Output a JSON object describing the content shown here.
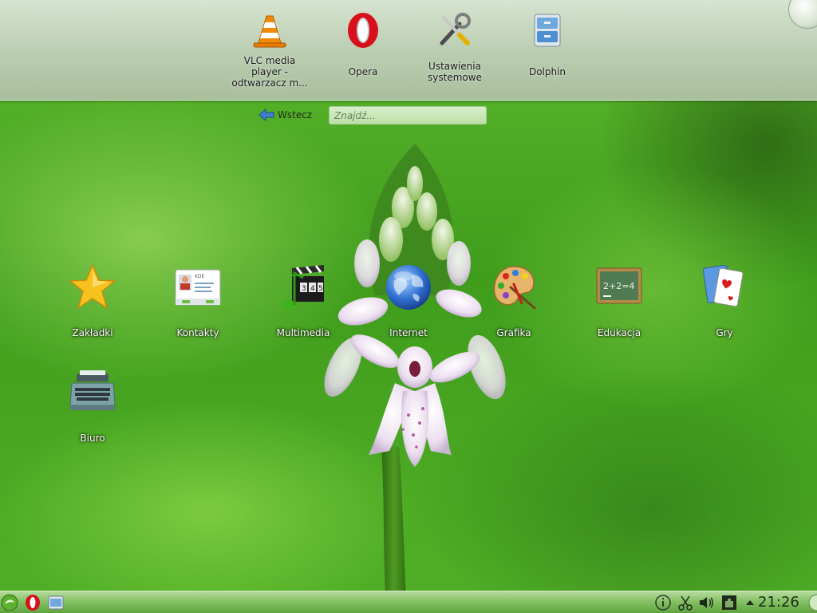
{
  "favorites": [
    {
      "name": "VLC media player - odtwarzacz m...",
      "label_lines": [
        "VLC media",
        "player -",
        "odtwarzacz m..."
      ],
      "icon": "vlc-cone-icon"
    },
    {
      "name": "Opera",
      "label_lines": [
        "Opera"
      ],
      "icon": "opera-icon"
    },
    {
      "name": "Ustawienia systemowe",
      "label_lines": [
        "Ustawienia",
        "systemowe"
      ],
      "icon": "system-settings-icon"
    },
    {
      "name": "Dolphin",
      "label_lines": [
        "Dolphin"
      ],
      "icon": "dolphin-file-manager-icon"
    }
  ],
  "navigation": {
    "back_label": "Wstecz",
    "search_placeholder": "Znajdź..."
  },
  "categories": [
    {
      "label": "Zakładki",
      "icon": "star-bookmarks-icon"
    },
    {
      "label": "Kontakty",
      "icon": "contacts-card-icon"
    },
    {
      "label": "Multimedia",
      "icon": "multimedia-clapper-icon"
    },
    {
      "label": "Internet",
      "icon": "globe-icon"
    },
    {
      "label": "Grafika",
      "icon": "paint-palette-icon"
    },
    {
      "label": "Edukacja",
      "icon": "chalkboard-icon"
    },
    {
      "label": "Gry",
      "icon": "playing-cards-icon"
    },
    {
      "label": "Biuro",
      "icon": "typewriter-icon"
    }
  ],
  "education_board_text": "2+2=4",
  "contacts_card_text": "KDE",
  "multimedia_clapper_digits": [
    "3",
    "4",
    "5"
  ],
  "taskbar": {
    "launchers": [
      "kde-launcher-icon",
      "opera-icon",
      "dolphin-icon"
    ],
    "tray": [
      "info-icon",
      "scissors-klipper-icon",
      "volume-icon",
      "network-icon",
      "tray-expand-icon"
    ],
    "clock": "21:26"
  },
  "colors": {
    "favorites_bar": "#b9ccb0",
    "taskbar": "#86c266",
    "wallpaper": "#3f9d1c",
    "opera_red": "#d8101c",
    "vlc_orange": "#f08a00"
  }
}
